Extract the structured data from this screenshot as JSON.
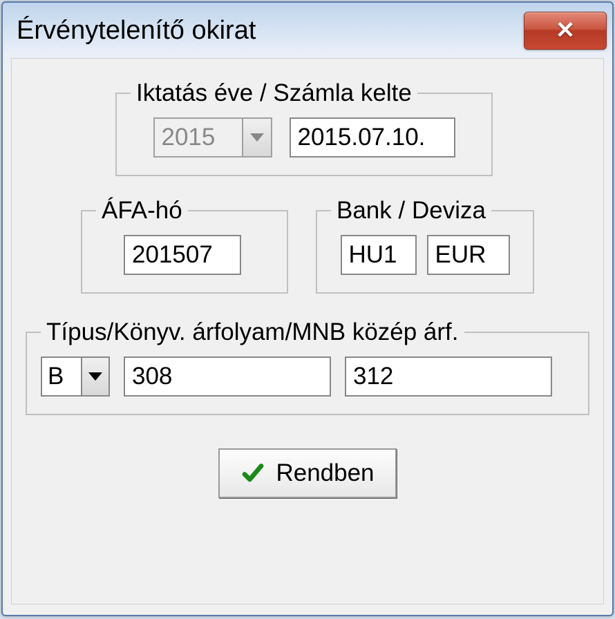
{
  "window": {
    "title": "Érvénytelenítő okirat"
  },
  "group1": {
    "legend": "Iktatás éve / Számla kelte",
    "year": "2015",
    "date": "2015.07.10."
  },
  "group_afa": {
    "legend": "ÁFA-hó",
    "value": "201507"
  },
  "group_bank": {
    "legend": "Bank / Deviza",
    "bank": "HU1",
    "currency": "EUR"
  },
  "group_rate": {
    "legend": "Típus/Könyv. árfolyam/MNB közép árf.",
    "type": "B",
    "rate1": "308",
    "rate2": "312"
  },
  "buttons": {
    "ok": "Rendben"
  },
  "icons": {
    "close": "close-icon",
    "check": "check-icon",
    "dropdown": "chevron-down-icon"
  }
}
